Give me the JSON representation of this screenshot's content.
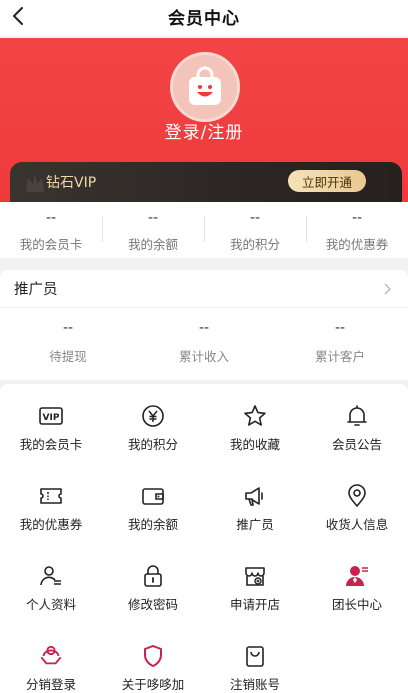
{
  "navbar": {
    "title": "会员中心"
  },
  "hero": {
    "login_text": "登录/注册"
  },
  "vip": {
    "label": "钻石VIP",
    "button": "立即开通"
  },
  "stats": [
    {
      "value": "--",
      "label": "我的会员卡"
    },
    {
      "value": "--",
      "label": "我的余额"
    },
    {
      "value": "--",
      "label": "我的积分"
    },
    {
      "value": "--",
      "label": "我的优惠券"
    }
  ],
  "promoter": {
    "title": "推广员",
    "stats": [
      {
        "value": "--",
        "label": "待提现"
      },
      {
        "value": "--",
        "label": "累计收入"
      },
      {
        "value": "--",
        "label": "累计客户"
      }
    ]
  },
  "grid": [
    {
      "label": "我的会员卡",
      "icon": "vip-card-icon"
    },
    {
      "label": "我的积分",
      "icon": "points-coin-icon"
    },
    {
      "label": "我的收藏",
      "icon": "star-icon"
    },
    {
      "label": "会员公告",
      "icon": "bell-icon"
    },
    {
      "label": "我的优惠券",
      "icon": "coupon-icon"
    },
    {
      "label": "我的余额",
      "icon": "wallet-icon"
    },
    {
      "label": "推广员",
      "icon": "megaphone-icon"
    },
    {
      "label": "收货人信息",
      "icon": "location-pin-icon"
    },
    {
      "label": "个人资料",
      "icon": "user-profile-icon"
    },
    {
      "label": "修改密码",
      "icon": "lock-icon"
    },
    {
      "label": "申请开店",
      "icon": "store-icon"
    },
    {
      "label": "团长中心",
      "icon": "leader-icon"
    },
    {
      "label": "分销登录",
      "icon": "distribution-icon"
    },
    {
      "label": "关于哆哆加",
      "icon": "shield-icon"
    },
    {
      "label": "注销账号",
      "icon": "bag-icon"
    }
  ],
  "colors": {
    "primary_red": "#ef3a3c",
    "vip_gold": "#f0d9a6",
    "accent_pink": "#c8234f"
  }
}
